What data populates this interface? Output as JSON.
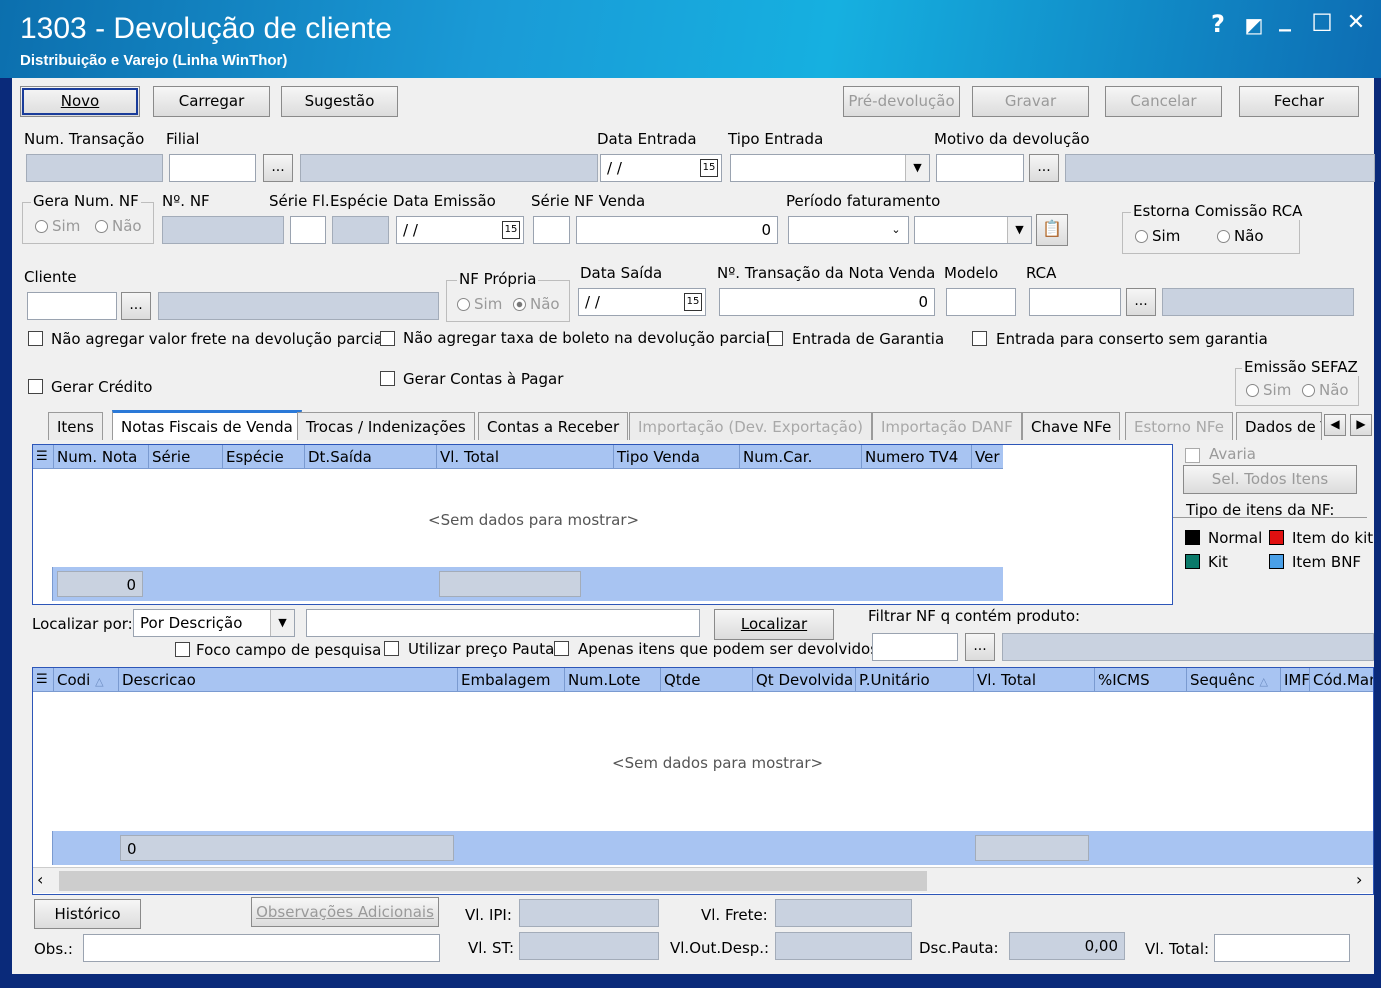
{
  "window": {
    "title": "1303 - Devolução de cliente",
    "subtitle": "Distribuição e Varejo (Linha WinThor)",
    "help": "?",
    "restore": "◩",
    "minimize": "_",
    "maximize": "☐",
    "close": "✕"
  },
  "toolbar": {
    "novo": "Novo",
    "carregar": "Carregar",
    "sugestao": "Sugestão",
    "pre_devolucao": "Pré-devolução",
    "gravar": "Gravar",
    "cancelar": "Cancelar",
    "fechar": "Fechar"
  },
  "labels": {
    "num_transacao": "Num. Transação",
    "filial": "Filial",
    "data_entrada": "Data Entrada",
    "tipo_entrada": "Tipo Entrada",
    "motivo_devolucao": "Motivo da devolução",
    "gera_num_nf": "Gera Num. NF",
    "sim": "Sim",
    "nao": "Não",
    "no_nf": "Nº. NF",
    "serie_fl": "Série Fl.",
    "especie": "Espécie",
    "data_emissao": "Data Emissão",
    "serie": "Série",
    "nf_venda": "NF Venda",
    "periodo_faturamento": "Período faturamento",
    "estorna_comissao": "Estorna Comissão RCA",
    "cliente": "Cliente",
    "nf_propria": "NF Própria",
    "data_saida": "Data Saída",
    "no_transacao_venda": "Nº. Transação da Nota Venda",
    "modelo": "Modelo",
    "rca": "RCA",
    "emissao_sefaz": "Emissão SEFAZ",
    "dots": "...",
    "calendar": "15"
  },
  "values": {
    "date_empty": "/ /",
    "nf_venda": "0",
    "transacao_venda": "0"
  },
  "checks": {
    "nao_agregar_frete": "Não agregar valor frete na devolução parcial",
    "nao_agregar_boleto": "Não agregar taxa de boleto na devolução parcial.",
    "entrada_garantia": "Entrada de Garantia",
    "entrada_conserto": "Entrada para conserto sem garantia",
    "gerar_credito": "Gerar Crédito",
    "gerar_contas": "Gerar Contas à Pagar"
  },
  "tabs": [
    "Itens",
    "Notas Fiscais de Venda",
    "Trocas / Indenizações",
    "Contas a Receber",
    "Importação (Dev. Exportação)",
    "Importação DANF",
    "Chave NFe",
    "Estorno NFe",
    "Dados de T"
  ],
  "grid1": {
    "columns": [
      "Num. Nota",
      "Série",
      "Espécie",
      "Dt.Saída",
      "Vl. Total",
      "Tipo Venda",
      "Num.Car.",
      "Numero TV4",
      "Ver"
    ],
    "empty": "<Sem dados para mostrar>",
    "footer_count": "0"
  },
  "side": {
    "avaria": "Avaria",
    "sel_todos": "Sel. Todos Itens",
    "tipo_itens": "Tipo de itens da NF:",
    "legend": [
      {
        "label": "Normal",
        "color": "#000000"
      },
      {
        "label": "Item do kit",
        "color": "#e01010"
      },
      {
        "label": "Kit",
        "color": "#0a7a6a"
      },
      {
        "label": "Item BNF",
        "color": "#4aa0e8"
      }
    ]
  },
  "search": {
    "localizar_por": "Localizar por:",
    "option": "Por Descrição",
    "localizar": "Localizar",
    "filtrar": "Filtrar NF q contém produto:",
    "foco": "Foco campo de pesquisa",
    "preco_pauta": "Utilizar preço Pauta",
    "apenas_itens": "Apenas itens que podem ser devolvidos"
  },
  "grid2": {
    "columns": [
      "Codi",
      "Descricao",
      "Embalagem",
      "Num.Lote",
      "Qtde",
      "Qt Devolvida",
      "P.Unitário",
      "Vl. Total",
      "%ICMS",
      "Sequênc",
      "IMF",
      "Cód.Mar"
    ],
    "empty": "<Sem dados para mostrar>",
    "footer_count": "0"
  },
  "bottom": {
    "historico": "Histórico",
    "observacoes": "Observações Adicionais",
    "vl_ipi": "Vl. IPI:",
    "vl_frete": "Vl. Frete:",
    "obs": "Obs.:",
    "vl_st": "Vl. ST:",
    "vl_out_desp": "Vl.Out.Desp.:",
    "dsc_pauta": "Dsc.Pauta:",
    "dsc_pauta_value": "0,00",
    "vl_total": "Vl. Total:"
  }
}
